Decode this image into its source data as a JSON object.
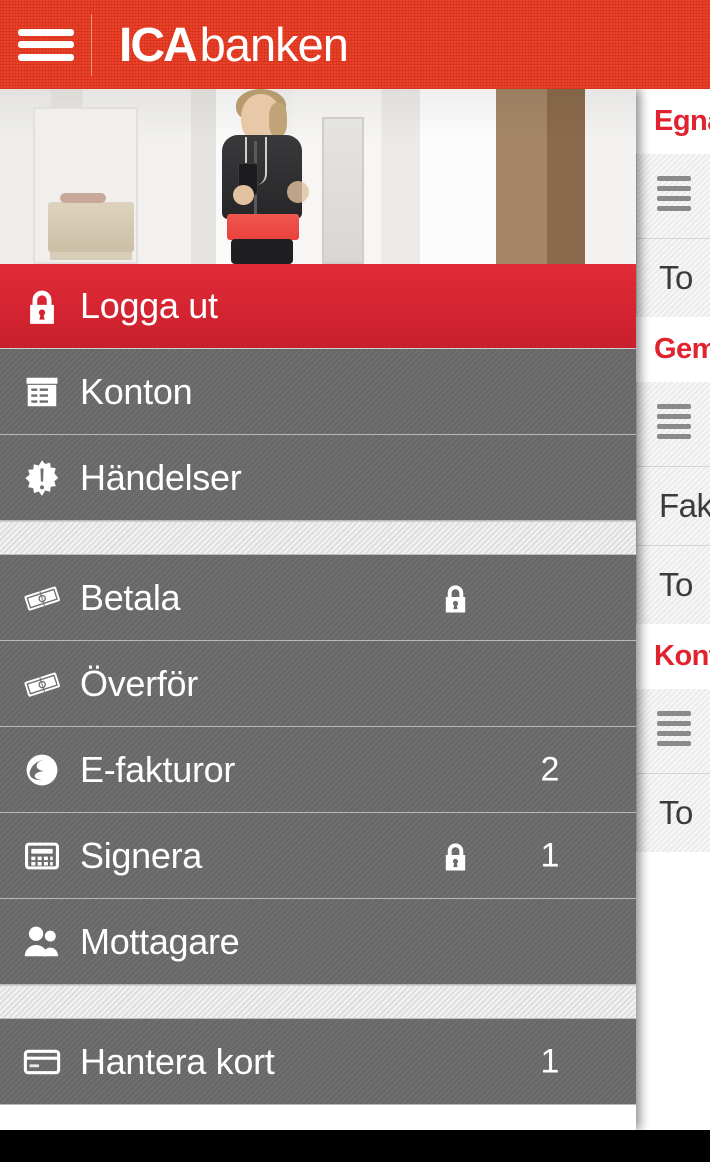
{
  "header": {
    "menu_icon": "hamburger-icon",
    "logo_primary": "ICA",
    "logo_secondary": "banken",
    "background_color": "#e8361d"
  },
  "hero": {
    "alt": "woman in athletic wear holding phone in hallway"
  },
  "drawer": {
    "accent_color": "#d92432",
    "background_color": "#6e6e6e",
    "groups": [
      {
        "items": [
          {
            "label": "Logga ut",
            "icon": "lock-icon",
            "active": true,
            "lock": false,
            "count": ""
          },
          {
            "label": "Konton",
            "icon": "ledger-icon",
            "active": false,
            "lock": false,
            "count": ""
          },
          {
            "label": "Händelser",
            "icon": "alert-burst-icon",
            "active": false,
            "lock": false,
            "count": ""
          }
        ]
      },
      {
        "items": [
          {
            "label": "Betala",
            "icon": "banknote-icon",
            "active": false,
            "lock": true,
            "count": ""
          },
          {
            "label": "Överför",
            "icon": "banknote-icon",
            "active": false,
            "lock": false,
            "count": ""
          },
          {
            "label": "E-fakturor",
            "icon": "einvoice-icon",
            "active": false,
            "lock": false,
            "count": "2"
          },
          {
            "label": "Signera",
            "icon": "calculator-icon",
            "active": false,
            "lock": true,
            "count": "1"
          },
          {
            "label": "Mottagare",
            "icon": "people-icon",
            "active": false,
            "lock": false,
            "count": ""
          }
        ]
      },
      {
        "items": [
          {
            "label": "Hantera kort",
            "icon": "credit-card-icon",
            "active": false,
            "lock": false,
            "count": "1"
          }
        ]
      }
    ]
  },
  "right_panel": {
    "accent_color": "#e1232f",
    "sections": [
      {
        "title": "Egna",
        "list_icon": "list-icon",
        "rows": [
          "To"
        ]
      },
      {
        "title": "Gem",
        "list_icon": "list-icon",
        "rows": [
          "Fak",
          "To"
        ]
      },
      {
        "title": "Kont",
        "list_icon": "list-icon",
        "rows": [
          "To"
        ]
      }
    ]
  }
}
